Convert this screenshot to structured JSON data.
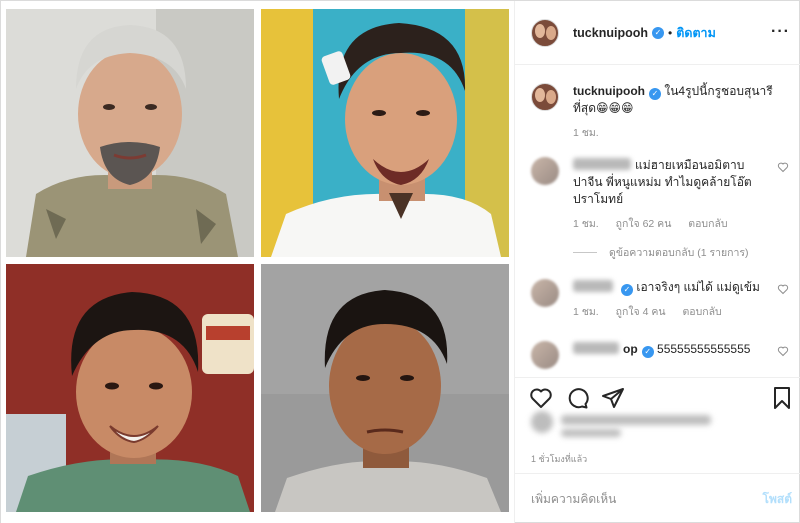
{
  "header": {
    "username": "tucknuipooh",
    "separator": "•",
    "follow_label": "ติดตาม",
    "more_label": "···"
  },
  "caption": {
    "username": "tucknuipooh",
    "text": "ใน4รูปนี้กรูชอบสุนารีที่สุด😁😁😁",
    "time": "1 ชม."
  },
  "comments": [
    {
      "text": "แม่ฮายเหมือนอมิตาบ ปาจีน พี่หนูแหม่ม ทำไมดูคล้ายโอ๊ต ปราโมทย์",
      "time": "1 ชม.",
      "likes": "ถูกใจ 62 คน",
      "reply_label": "ตอบกลับ"
    },
    {
      "text": "เอาจริงๆ แม่ได้ แม่ดูเข้ม",
      "time": "1 ชม.",
      "likes": "ถูกใจ 4 คน",
      "reply_label": "ตอบกลับ"
    },
    {
      "name_suffix": "op",
      "text": "55555555555555"
    }
  ],
  "view_replies_label": "ดูข้อความตอบกลับ (1 รายการ)",
  "post_time": "1 ชั่วโมงที่แล้ว",
  "add_comment": {
    "placeholder": "เพิ่มความคิดเห็น",
    "post_label": "โพสต์"
  },
  "colors": {
    "link_blue": "#0095f6",
    "verified_blue": "#3897f0",
    "muted_gray": "#8e8e8e"
  }
}
